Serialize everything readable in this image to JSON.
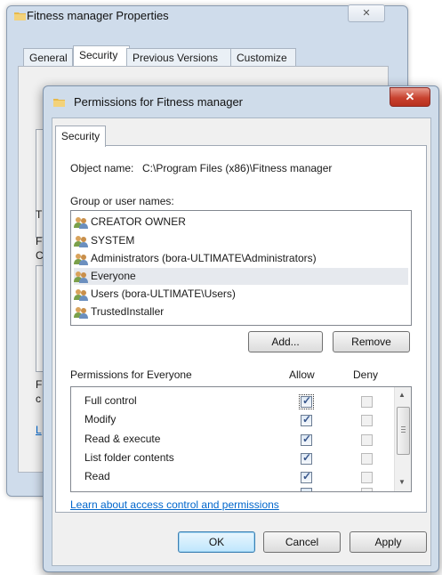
{
  "back_window": {
    "title": "Fitness manager Properties",
    "close_glyph": "✕",
    "tabs": [
      "General",
      "Security",
      "Previous Versions",
      "Customize"
    ],
    "selected_tab": "Security",
    "left_fragments": [
      "T",
      "F",
      "C",
      "F",
      "c",
      "L"
    ]
  },
  "dialog": {
    "title": "Permissions for Fitness manager",
    "close_glyph": "✕",
    "tab": "Security",
    "object_label": "Object name:",
    "object_value": "C:\\Program Files (x86)\\Fitness manager",
    "group_label": "Group or user names:",
    "users": [
      "CREATOR OWNER",
      "SYSTEM",
      "Administrators (bora-ULTIMATE\\Administrators)",
      "Everyone",
      "Users (bora-ULTIMATE\\Users)",
      "TrustedInstaller"
    ],
    "selected_user": "Everyone",
    "add_button": "Add...",
    "remove_button": "Remove",
    "perm_label": "Permissions for Everyone",
    "allow_header": "Allow",
    "deny_header": "Deny",
    "permissions": [
      {
        "name": "Full control",
        "allow": true,
        "deny": false
      },
      {
        "name": "Modify",
        "allow": true,
        "deny": false
      },
      {
        "name": "Read & execute",
        "allow": true,
        "deny": false
      },
      {
        "name": "List folder contents",
        "allow": true,
        "deny": false
      },
      {
        "name": "Read",
        "allow": true,
        "deny": false
      }
    ],
    "link": "Learn about access control and permissions",
    "ok_button": "OK",
    "cancel_button": "Cancel",
    "apply_button": "Apply"
  },
  "colors": {
    "title_glass": "#cfdcea",
    "close_red": "#c8422f",
    "link": "#0066cc",
    "default_button": "#bee6fd"
  }
}
